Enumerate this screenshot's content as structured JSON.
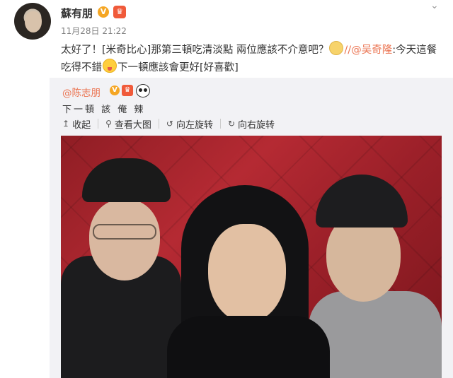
{
  "post": {
    "author": "蘇有朋",
    "verified_badge": "V",
    "timestamp": "11月28日 21:22",
    "text_part1": "太好了！[米奇比心]那第三頓吃清淡點 兩位應該不介意吧？",
    "text_mention": "//@吴奇隆",
    "text_part2": ":今天這餐吃得不錯",
    "text_part3": "下一頓應該會更好[好喜歡]"
  },
  "repost": {
    "author": "@陈志朋",
    "verified_badge": "V",
    "text": "下一頓 該 俺 辣",
    "toolbar": [
      {
        "icon": "collapse-icon",
        "glyph": "↥",
        "label": "收起"
      },
      {
        "icon": "zoom-icon",
        "glyph": "⚲",
        "label": "查看大图"
      },
      {
        "icon": "rotate-left-icon",
        "glyph": "↺",
        "label": "向左旋转"
      },
      {
        "icon": "rotate-right-icon",
        "glyph": "↻",
        "label": "向右旋转"
      }
    ]
  },
  "ui": {
    "more_arrow": "⌄"
  },
  "colors": {
    "mention": "#eb7350",
    "repost_bg": "#f2f2f5",
    "badge": "#f5a623"
  }
}
